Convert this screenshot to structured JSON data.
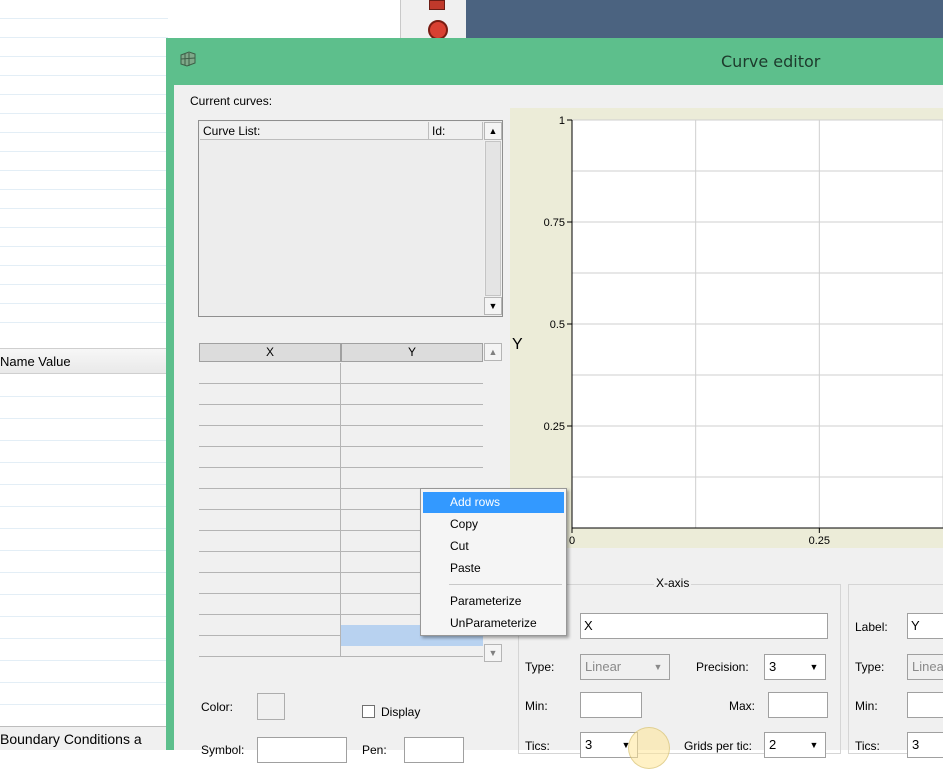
{
  "background_app": {
    "property_header": "Name Value",
    "bottom_tab": "Boundary Conditions a"
  },
  "dialog": {
    "title": "Curve editor",
    "current_curves_label": "Current curves:",
    "curve_list": {
      "columns": [
        "Curve List:",
        "Id:"
      ]
    },
    "xy_table": {
      "columns": [
        "X",
        "Y"
      ],
      "row_count": 14
    },
    "context_menu": {
      "items": [
        "Add rows",
        "Copy",
        "Cut",
        "Paste",
        "Parameterize",
        "UnParameterize"
      ],
      "highlighted": "Add rows"
    },
    "plot": {
      "y_axis_title": "Y",
      "x_axis_title": "X-axis"
    },
    "x_axis_panel": {
      "label_value": "X",
      "type_label": "Type:",
      "type_value": "Linear",
      "precision_label": "Precision:",
      "precision_value": "3",
      "min_label": "Min:",
      "max_label": "Max:",
      "tics_label": "Tics:",
      "tics_value": "3",
      "grids_label": "Grids per tic:",
      "grids_value": "2"
    },
    "y_axis_panel": {
      "label_label": "Label:",
      "label_value": "Y",
      "type_label": "Type:",
      "type_value": "Linea",
      "min_label": "Min:",
      "tics_label": "Tics:",
      "tics_value": "3"
    },
    "color_label": "Color:",
    "display_label": "Display",
    "symbol_label": "Symbol:",
    "pen_label": "Pen:"
  },
  "chart_data": {
    "type": "line",
    "title": "",
    "xlabel": "X-axis",
    "ylabel": "Y",
    "x_ticks": [
      "0",
      "0.25"
    ],
    "y_ticks": [
      "0.25",
      "0.5",
      "0.75",
      "1"
    ],
    "xlim": [
      0,
      0.375
    ],
    "ylim": [
      0,
      1
    ],
    "grid": true,
    "series": []
  }
}
